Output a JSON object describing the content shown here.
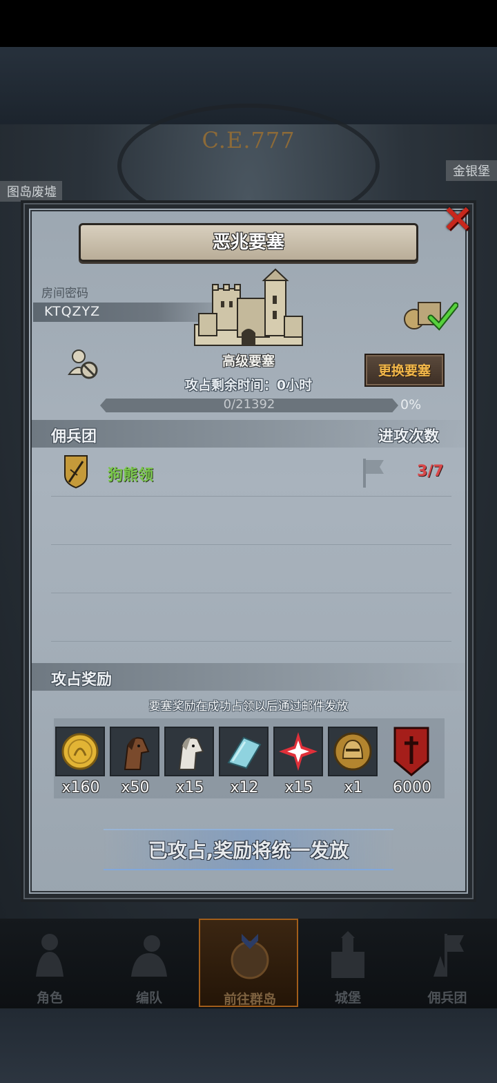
{
  "map": {
    "era": "C.E.777",
    "left_label": "图岛废墟",
    "right_label": "金银堡"
  },
  "dialog": {
    "title": "恶兆要塞",
    "room_label": "房间密码",
    "room_code": "KTQZYZ",
    "fortress_level": "高级要塞",
    "time_left": "攻占剩余时间：0小时",
    "progress": {
      "text": "0/21392",
      "percent_text": "0%",
      "value": 0,
      "max": 21392
    },
    "change_button": "更换要塞",
    "close": "×",
    "mercenary_header": "佣兵团",
    "attack_header": "进攻次数",
    "mercenaries": [
      {
        "name": "狗熊领",
        "attacks": "3/7"
      }
    ],
    "reward_header": "攻占奖励",
    "reward_note": "要塞奖励在成功占领以后通过邮件发放",
    "rewards": [
      {
        "icon": "gold-coin-icon",
        "qty": "x160"
      },
      {
        "icon": "brown-horse-icon",
        "qty": "x50"
      },
      {
        "icon": "white-horse-icon",
        "qty": "x15"
      },
      {
        "icon": "cloth-scroll-icon",
        "qty": "x12"
      },
      {
        "icon": "red-star-icon",
        "qty": "x15"
      },
      {
        "icon": "knight-helmet-icon",
        "qty": "x1"
      },
      {
        "icon": "war-banner-icon",
        "qty": "6000"
      }
    ],
    "claimed_text": "已攻占,奖励将统一发放"
  },
  "nav": [
    {
      "label": "角色",
      "icon": "knight-icon"
    },
    {
      "label": "编队",
      "icon": "squad-icon"
    },
    {
      "label": "前往群岛",
      "icon": "compass-icon",
      "active": true
    },
    {
      "label": "城堡",
      "icon": "castle-icon"
    },
    {
      "label": "佣兵团",
      "icon": "mercenary-icon"
    }
  ],
  "colors": {
    "accent_gold": "#f3b84a",
    "close_red": "#c8271c",
    "guild_green": "#79c64a",
    "attack_red": "#d8484a"
  }
}
